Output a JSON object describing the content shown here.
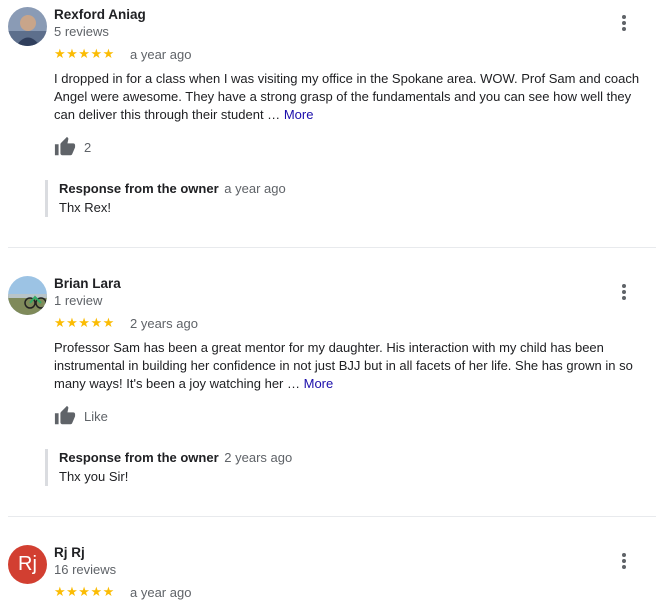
{
  "reviews": [
    {
      "name": "Rexford Aniag",
      "count": "5 reviews",
      "stars": "★★★★★",
      "when": "a year ago",
      "text": "I dropped in for a class when I was visiting my office in the Spokane area.  WOW.  Prof Sam and coach Angel were awesome.  They have a strong grasp of the fundamentals and you can see how well they can deliver this through their student …",
      "more": "More",
      "likes": "2",
      "response_title": "Response from the owner",
      "response_when": "a year ago",
      "response_text": "Thx Rex!"
    },
    {
      "name": "Brian Lara",
      "count": "1 review",
      "stars": "★★★★★",
      "when": "2 years ago",
      "text": "Professor Sam has been a great mentor for my daughter. His interaction with my child has been instrumental in building her confidence in not just BJJ but in all facets of her life. She has grown in so many ways! It's been a joy watching her …",
      "more": "More",
      "likes": "Like",
      "response_title": "Response from the owner",
      "response_when": "2 years ago",
      "response_text": "Thx you Sir!"
    },
    {
      "name": "Rj Rj",
      "avatar_initials": "Rj",
      "count": "16 reviews",
      "stars": "★★★★★",
      "when": "a year ago"
    }
  ],
  "colors": {
    "star": "#fbbc04",
    "link": "#1a0dab",
    "avatar_rj": "#d23f31"
  }
}
